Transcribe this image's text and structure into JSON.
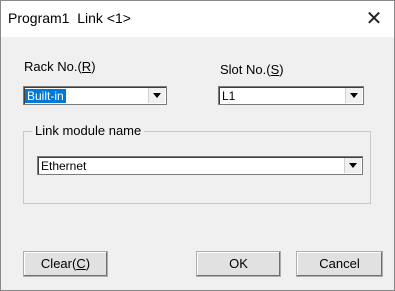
{
  "window": {
    "title": "Program1  Link <1>",
    "close_glyph": "✕"
  },
  "rack": {
    "label_prefix": "Rack No.(",
    "label_key": "R",
    "label_suffix": ")",
    "value": "Built-in"
  },
  "slot": {
    "label_prefix": "Slot No.(",
    "label_key": "S",
    "label_suffix": ")",
    "value": "L1"
  },
  "link_module": {
    "group_label": "Link module name",
    "value": "Ethernet"
  },
  "buttons": {
    "clear_prefix": "Clear(",
    "clear_key": "C",
    "clear_suffix": ")",
    "ok": "OK",
    "cancel": "Cancel"
  }
}
